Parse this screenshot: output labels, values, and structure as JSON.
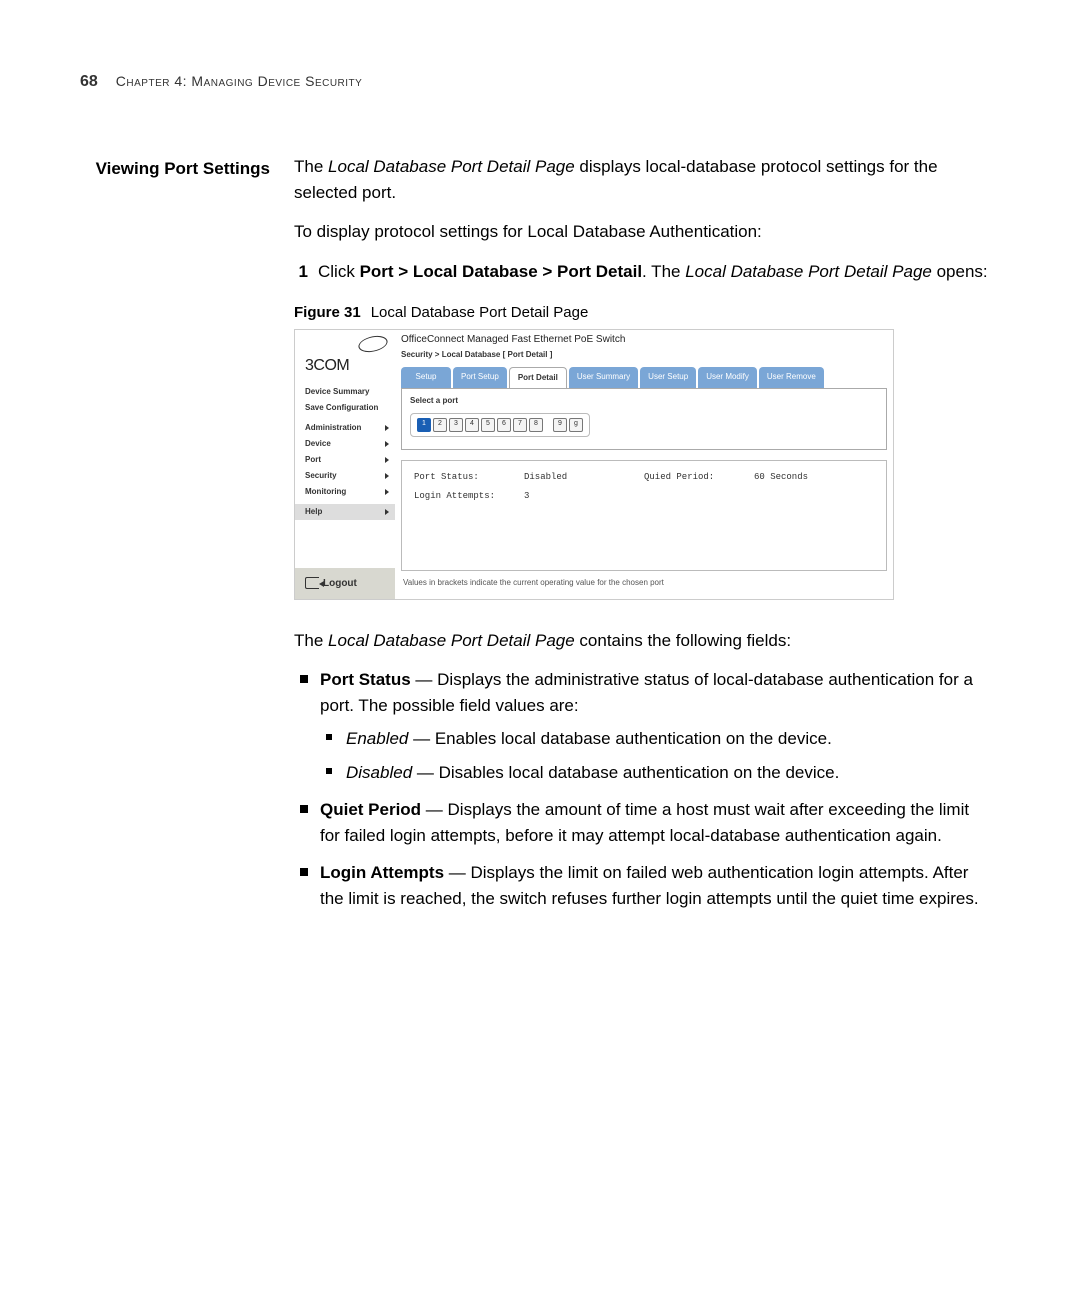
{
  "page": {
    "number": "68",
    "chapter": "Chapter 4: Managing Device Security"
  },
  "section": {
    "heading": "Viewing Port Settings",
    "intro_1_a": "The ",
    "intro_1_em": "Local Database Port Detail Page",
    "intro_1_b": " displays local-database protocol settings for the selected port.",
    "intro_2": "To display protocol settings for Local Database Authentication:",
    "step_num": "1",
    "step_a": "Click ",
    "step_bold": "Port > Local Database > Port Detail",
    "step_b": ". The ",
    "step_em": "Local Database Port Detail Page",
    "step_c": " opens:"
  },
  "figure": {
    "label": "Figure 31",
    "caption": "Local Database Port Detail Page",
    "logo": "3COM",
    "app_title": "OfficeConnect Managed Fast Ethernet PoE Switch",
    "breadcrumb": "Security > Local Database [ Port Detail ]",
    "nav_links": {
      "summary": "Device Summary",
      "saveconf": "Save Configuration"
    },
    "nav_items": [
      "Administration",
      "Device",
      "Port",
      "Security",
      "Monitoring",
      "Help"
    ],
    "logout": "Logout",
    "tabs": [
      "Setup",
      "Port Setup",
      "Port Detail",
      "User Summary",
      "User Setup",
      "User Modify",
      "User Remove"
    ],
    "active_tab_index": 2,
    "select_label": "Select a port",
    "ports_a": [
      "1",
      "2",
      "3",
      "4",
      "5",
      "6",
      "7",
      "8"
    ],
    "ports_b": [
      "9",
      "g"
    ],
    "selected_port": "1",
    "fields": {
      "port_status_label": "Port Status:",
      "port_status_value": "Disabled",
      "quiet_label": "Quied Period:",
      "quiet_value": "60 Seconds",
      "login_label": "Login Attempts:",
      "login_value": "3"
    },
    "footnote": "Values in brackets indicate the current operating value for the chosen port"
  },
  "after_fig": {
    "lead_a": "The ",
    "lead_em": "Local Database Port Detail Page",
    "lead_b": " contains the following fields:"
  },
  "bullets": {
    "b1_bold": "Port Status",
    "b1_rest": " — Displays the administrative status of local-database authentication for a port. The possible field values are:",
    "b1a_em": "Enabled",
    "b1a_rest": " — Enables local database authentication on the device.",
    "b1b_em": "Disabled",
    "b1b_rest": " — Disables local database authentication on the device.",
    "b2_bold": "Quiet Period",
    "b2_rest": " — Displays the amount of time a host must wait after exceeding the limit for failed login attempts, before it may attempt local-database authentication again.",
    "b3_bold": "Login Attempts",
    "b3_rest": " — Displays the limit on failed web authentication login attempts. After the limit is reached, the switch refuses further login attempts until the quiet time expires."
  }
}
